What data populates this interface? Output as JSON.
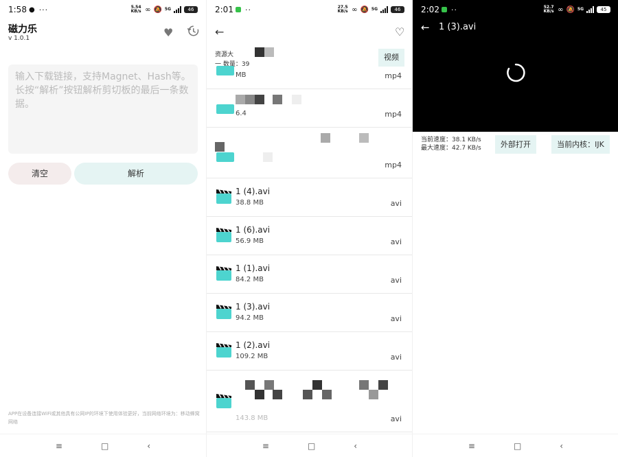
{
  "screen1": {
    "status": {
      "time": "1:58",
      "speed": "5.54 KB/s",
      "signal": "5G",
      "battery": "46"
    },
    "app_name": "磁力乐",
    "version": "v 1.0.1",
    "input_placeholder": "输入下载链接，支持Magnet、Hash等。\n长按“解析”按钮解析剪切板的最后一条数据。",
    "clear_label": "清空",
    "parse_label": "解析",
    "footer_note": "APP在设备连接WiFi或其他具有公网IP的环境下使用体验更好，当前网络环境为：移动蜂窝网络"
  },
  "screen2": {
    "status": {
      "time": "2:01",
      "speed": "27.5 KB/s",
      "signal": "5G",
      "battery": "46"
    },
    "source_label": "资源大",
    "file_count_label": "一 数量：39",
    "video_button": "视频",
    "files_partial": [
      {
        "size": "MB",
        "ext": "mp4"
      },
      {
        "size": "6.4",
        "ext": "mp4"
      },
      {
        "size": "",
        "ext": "mp4"
      }
    ],
    "files": [
      {
        "name": "1 (4).avi",
        "size": "38.8 MB",
        "ext": "avi"
      },
      {
        "name": "1 (6).avi",
        "size": "56.9 MB",
        "ext": "avi"
      },
      {
        "name": "1 (1).avi",
        "size": "84.2 MB",
        "ext": "avi"
      },
      {
        "name": "1 (3).avi",
        "size": "94.2 MB",
        "ext": "avi"
      },
      {
        "name": "1 (2).avi",
        "size": "109.2 MB",
        "ext": "avi"
      },
      {
        "name": "",
        "size": "143.8 MB",
        "ext": "avi"
      }
    ]
  },
  "screen3": {
    "status": {
      "time": "2:02",
      "speed": "52.7 KB/s",
      "signal": "5G",
      "battery": "45"
    },
    "video_title": "1 (3).avi",
    "current_speed": "当前速度：38.1 KB/s",
    "max_speed": "最大速度：42.7 KB/s",
    "external_open": "外部打开",
    "current_core": "当前内核：IJK"
  },
  "icons": {
    "heart": "heart-icon",
    "history": "history-icon",
    "back": "back-arrow-icon",
    "clapperboard": "clapperboard-icon",
    "spinner": "loading-spinner-icon"
  },
  "colors": {
    "accent_teal": "#4dd4cf",
    "button_teal_bg": "#e5f4f3",
    "button_pink_bg": "#f4ecec"
  }
}
